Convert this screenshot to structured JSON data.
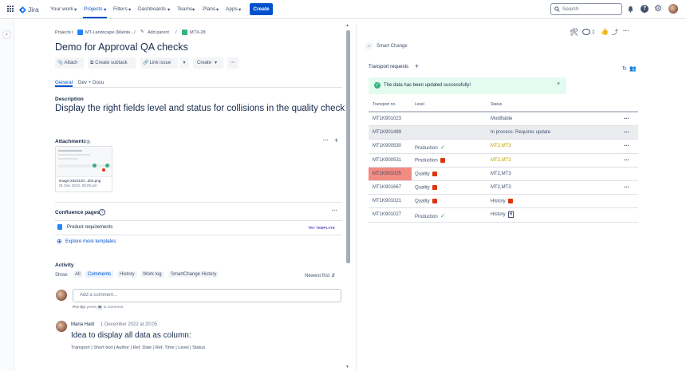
{
  "topbar": {
    "product": "Jira",
    "nav": [
      "Your work",
      "Projects",
      "Filters",
      "Dashboards",
      "Teams",
      "Plans",
      "Apps"
    ],
    "create_label": "Create",
    "search_placeholder": "Search"
  },
  "issue": {
    "breadcrumbs": {
      "projects": "Projects",
      "project": "MT-Landscape (Mainte...",
      "add_parent": "Add parent",
      "key": "MTX-28"
    },
    "title": "Demo for Approval QA checks",
    "buttons": {
      "attach": "Attach",
      "subtask": "Create subtask",
      "link": "Link issue",
      "create": "Create"
    },
    "tabs": [
      "General",
      "Dev + Docu"
    ],
    "description_heading": "Description",
    "description": "Display the right fields level and status for collisions in the quality checks",
    "attachments_heading": "Attachments",
    "attachments_count": "1",
    "attachment": {
      "name": "image-2022120...304.png",
      "date": "01 Dec 2022, 08:05 pm"
    },
    "confluence_heading": "Confluence pages",
    "confluence_item": "Product requirements",
    "try_template": "TRY TEMPLATE",
    "explore": "Explore more templates",
    "activity_heading": "Activity",
    "show_label": "Show:",
    "activity_tabs": [
      "All",
      "Comments",
      "History",
      "Work log",
      "SmartChange History"
    ],
    "sort": "Newest first",
    "comment_placeholder": "Add a comment...",
    "protip_prefix": "Pro tip:",
    "protip_text": "press",
    "protip_key": "M",
    "protip_suffix": "to comment",
    "comment": {
      "author": "Maria Hald",
      "date": "1 December 2022 at 20:05",
      "title": "Idea to display all data as column:",
      "body": "Transport | Short text | Author | Ref. Date | Ref. Time | Level | Status"
    }
  },
  "panel": {
    "watch_count": "1",
    "back_label": "Smart Change",
    "section_title": "Transport requests",
    "success_message": "The data has been updated successfully!",
    "columns": [
      "Transport no.",
      "Level",
      "Status"
    ],
    "rows": [
      {
        "no": "MT1K901023",
        "level": "",
        "level_icon": "",
        "status": "Modifiable",
        "status_icon": "",
        "more": true,
        "shaded": false,
        "highlight": false
      },
      {
        "no": "MT1K901499",
        "level": "",
        "level_icon": "",
        "status": "In process: Requires update",
        "status_icon": "",
        "more": true,
        "shaded": true,
        "highlight": false
      },
      {
        "no": "MT1K900530",
        "level": "Production",
        "level_icon": "check",
        "status": "MT2,MT3",
        "status_icon": "",
        "more": true,
        "shaded": false,
        "highlight": false,
        "status_color": "yellow"
      },
      {
        "no": "MT1K900531",
        "level": "Production",
        "level_icon": "warn",
        "status": "MT2,MT3",
        "status_icon": "",
        "more": true,
        "shaded": false,
        "highlight": false,
        "status_color": "yellow"
      },
      {
        "no": "MT1K901025",
        "level": "Quality",
        "level_icon": "warn",
        "status": "MT2,MT3",
        "status_icon": "",
        "more": false,
        "shaded": false,
        "highlight": true
      },
      {
        "no": "MT1K901667",
        "level": "Quality",
        "level_icon": "warn",
        "status": "MT2,MT3",
        "status_icon": "",
        "more": true,
        "shaded": false,
        "highlight": false
      },
      {
        "no": "MT1K901021",
        "level": "Quality",
        "level_icon": "warn",
        "status": "History",
        "status_icon": "flag",
        "more": false,
        "shaded": false,
        "highlight": false
      },
      {
        "no": "MT1K901027",
        "level": "Production",
        "level_icon": "check",
        "status": "History",
        "status_icon": "h",
        "more": false,
        "shaded": false,
        "highlight": false
      }
    ]
  },
  "colors": {
    "brand": "#0052cc",
    "success_bg": "#e3fcef",
    "highlight": "#f28b82",
    "shade": "#ebecf0"
  }
}
